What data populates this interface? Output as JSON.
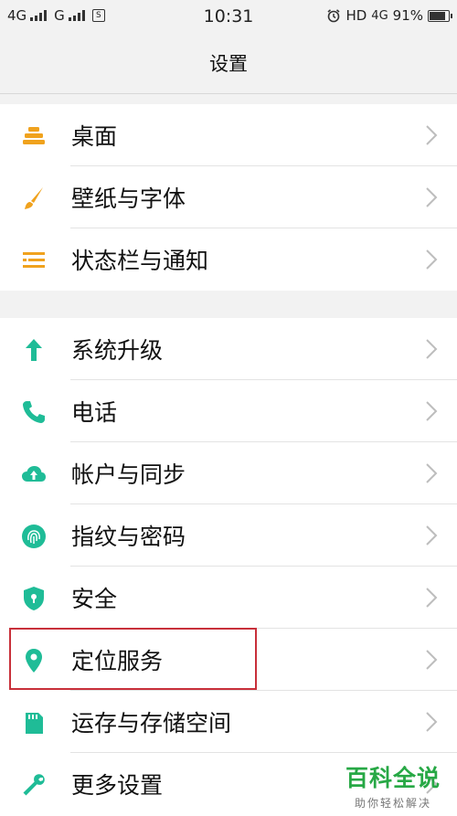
{
  "status_bar": {
    "network1": "4G",
    "network2": "G",
    "sim_label": "S",
    "time": "10:31",
    "hd": "HD",
    "network3": "4G",
    "battery": "91%",
    "battery_level": 0.91
  },
  "header": {
    "title": "设置"
  },
  "colors": {
    "orange": "#f0a21d",
    "teal": "#1fbc97",
    "highlight": "#c8303a",
    "watermark": "#27a845"
  },
  "sections": [
    {
      "items": [
        {
          "label": "桌面",
          "icon": "desktop-icon"
        },
        {
          "label": "壁纸与字体",
          "icon": "brush-icon"
        },
        {
          "label": "状态栏与通知",
          "icon": "notification-bar-icon"
        }
      ]
    },
    {
      "items": [
        {
          "label": "系统升级",
          "icon": "upgrade-arrow-icon"
        },
        {
          "label": "电话",
          "icon": "phone-icon"
        },
        {
          "label": "帐户与同步",
          "icon": "cloud-sync-icon"
        },
        {
          "label": "指纹与密码",
          "icon": "fingerprint-icon"
        },
        {
          "label": "安全",
          "icon": "shield-icon"
        },
        {
          "label": "定位服务",
          "icon": "location-pin-icon"
        },
        {
          "label": "运存与存储空间",
          "icon": "sd-card-icon"
        },
        {
          "label": "更多设置",
          "icon": "wrench-icon"
        }
      ]
    }
  ],
  "watermark": {
    "title": "百科全说",
    "subtitle": "助你轻松解决"
  }
}
